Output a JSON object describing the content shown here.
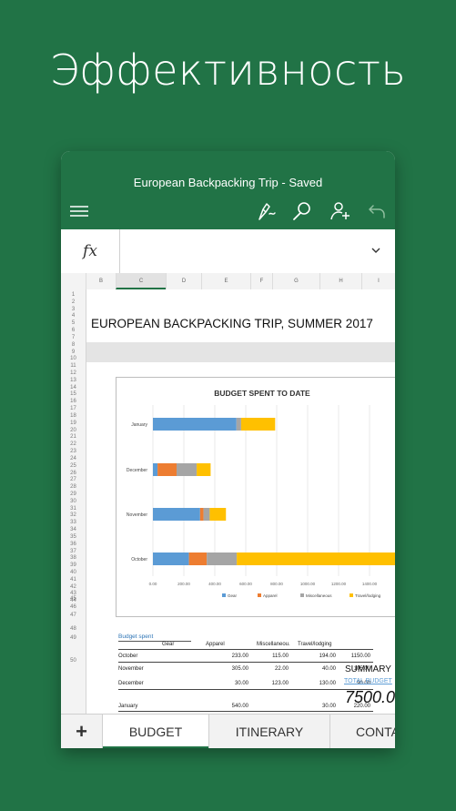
{
  "hero_title": "Эффективность",
  "app": {
    "doc_title": "European Backpacking Trip - Saved",
    "toolbar_icons": [
      "menu-icon",
      "pen-icon",
      "search-icon",
      "share-icon",
      "undo-icon"
    ]
  },
  "formula_bar": {
    "fx_label": "fx",
    "value": ""
  },
  "columns": [
    "B",
    "C",
    "D",
    "E",
    "F",
    "G",
    "H",
    "I"
  ],
  "selected_column": "C",
  "rows": [
    "1",
    "2",
    "3",
    "4",
    "5",
    "6",
    "7",
    "8",
    "9",
    "10",
    "11",
    "12",
    "13",
    "14",
    "15",
    "16",
    "17",
    "18",
    "19",
    "20",
    "21",
    "22",
    "23",
    "24",
    "25",
    "26",
    "27",
    "28",
    "29",
    "30",
    "31",
    "32",
    "33",
    "34",
    "35",
    "36",
    "37",
    "38",
    "39",
    "40",
    "41",
    "42",
    "43",
    "44",
    "45",
    "46",
    "47",
    "48",
    "49",
    "50"
  ],
  "sheet": {
    "title": "EUROPEAN BACKPACKING TRIP, SUMMER 2017",
    "budget_spent_label": "Budget spent",
    "table_headers": [
      "Gear",
      "Apparel",
      "Miscellaneou.",
      "Travel/lodging"
    ],
    "table_rows": [
      {
        "month": "October",
        "values": [
          "233.00",
          "115.00",
          "194.00",
          "1150.00"
        ]
      },
      {
        "month": "November",
        "values": [
          "305.00",
          "22.00",
          "40.00",
          "105.00"
        ]
      },
      {
        "month": "December",
        "values": [
          "30.00",
          "123.00",
          "130.00",
          "90.00"
        ]
      },
      {
        "month": "January",
        "values": [
          "540.00",
          "",
          "30.00",
          "220.00"
        ]
      }
    ],
    "summary_label": "SUMMARY",
    "total_budget_label": "TOTAL BUDGET",
    "total_budget_value": "7500.00"
  },
  "chart_data": {
    "type": "bar",
    "orientation": "horizontal",
    "stacked": true,
    "title": "BUDGET SPENT TO DATE",
    "categories": [
      "January",
      "December",
      "November",
      "October"
    ],
    "series": [
      {
        "name": "Gear",
        "color": "#5b9bd5",
        "values": [
          540,
          30,
          305,
          233
        ]
      },
      {
        "name": "Apparel",
        "color": "#ed7d31",
        "values": [
          0,
          123,
          22,
          115
        ]
      },
      {
        "name": "Miscellaneous",
        "color": "#a5a5a5",
        "values": [
          30,
          130,
          40,
          194
        ]
      },
      {
        "name": "Travel/lodging",
        "color": "#ffc000",
        "values": [
          220,
          90,
          105,
          1150
        ]
      }
    ],
    "x_ticks": [
      "0.00",
      "200.00",
      "400.00",
      "600.00",
      "800.00",
      "1000.00",
      "1200.00",
      "1400.00"
    ],
    "xlim": [
      0,
      1600
    ],
    "legend_position": "bottom",
    "grid": true
  },
  "tabs": {
    "add_label": "+",
    "items": [
      "BUDGET",
      "ITINERARY",
      "CONTA"
    ],
    "active": 0
  }
}
